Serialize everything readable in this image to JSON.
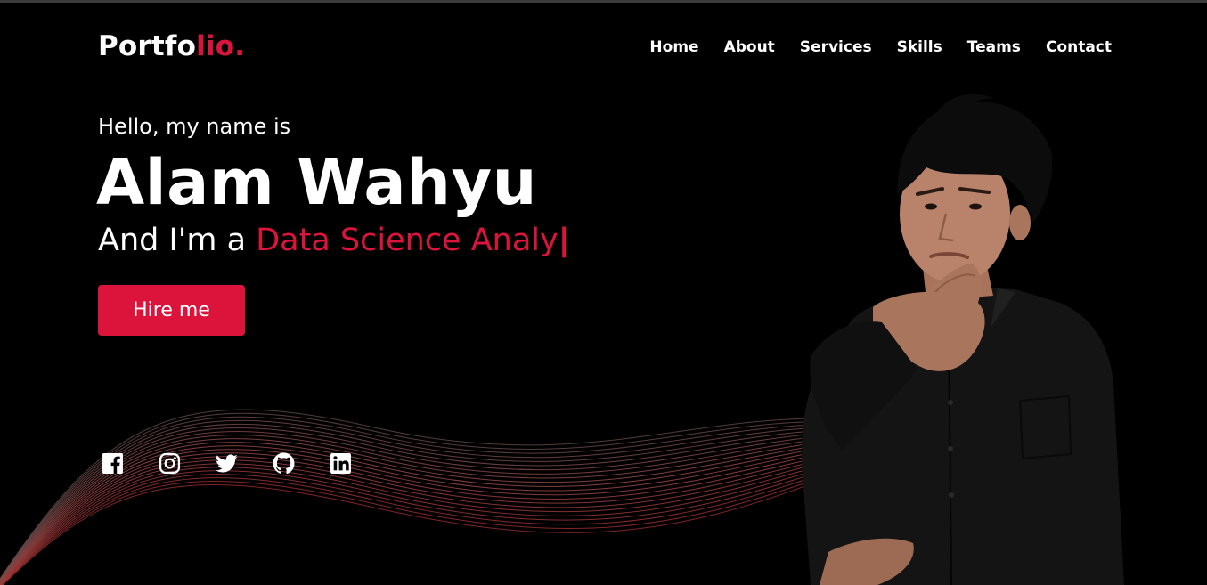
{
  "navbar": {
    "logo_main": "Portfo",
    "logo_accent": "lio.",
    "links": [
      {
        "label": "Home"
      },
      {
        "label": "About"
      },
      {
        "label": "Services"
      },
      {
        "label": "Skills"
      },
      {
        "label": "Teams"
      },
      {
        "label": "Contact"
      }
    ]
  },
  "hero": {
    "greeting": "Hello, my name is",
    "name": "Alam Wahyu",
    "role_prefix": "And I'm a ",
    "role_typed": "Data Science Analy",
    "cursor": "|",
    "hire_button": "Hire me"
  },
  "socials": [
    {
      "icon": "facebook-icon"
    },
    {
      "icon": "instagram-icon"
    },
    {
      "icon": "twitter-icon"
    },
    {
      "icon": "github-icon"
    },
    {
      "icon": "linkedin-icon"
    }
  ],
  "colors": {
    "accent": "#dc143c",
    "background": "#000000",
    "text": "#ffffff"
  }
}
